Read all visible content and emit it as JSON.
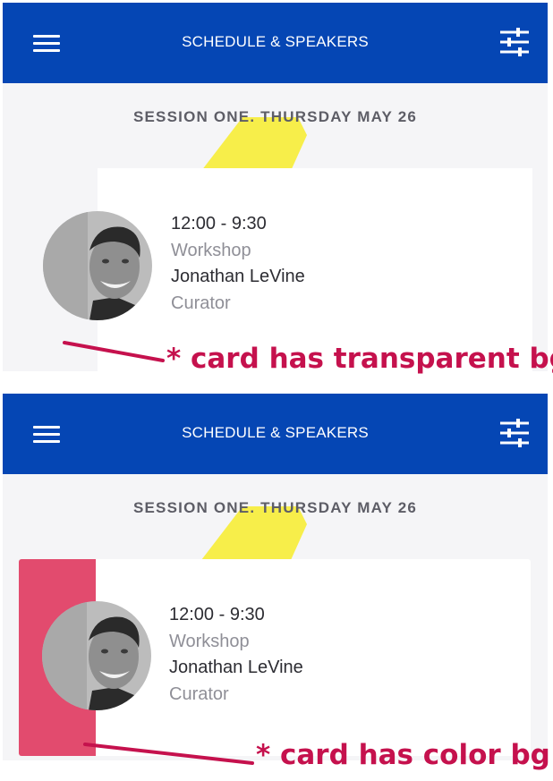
{
  "app_bar": {
    "title": "SCHEDULE & SPEAKERS",
    "menu_icon": "hamburger-menu-icon",
    "filter_icon": "sliders-filter-icon",
    "color": "#0546b4"
  },
  "session": {
    "title": "SESSION ONE. THURSDAY MAY 26"
  },
  "card": {
    "time": "12:00 - 9:30",
    "type": "Workshop",
    "speaker": "Jonathan LeVine",
    "role": "Curator",
    "accent_color": "#e24b6e"
  },
  "annotations": {
    "transparent": "* card has transparent bg",
    "color": "* card has color bg",
    "color_hex": "#c5114d"
  },
  "decor": {
    "highlight_color": "#f7ee4a"
  }
}
